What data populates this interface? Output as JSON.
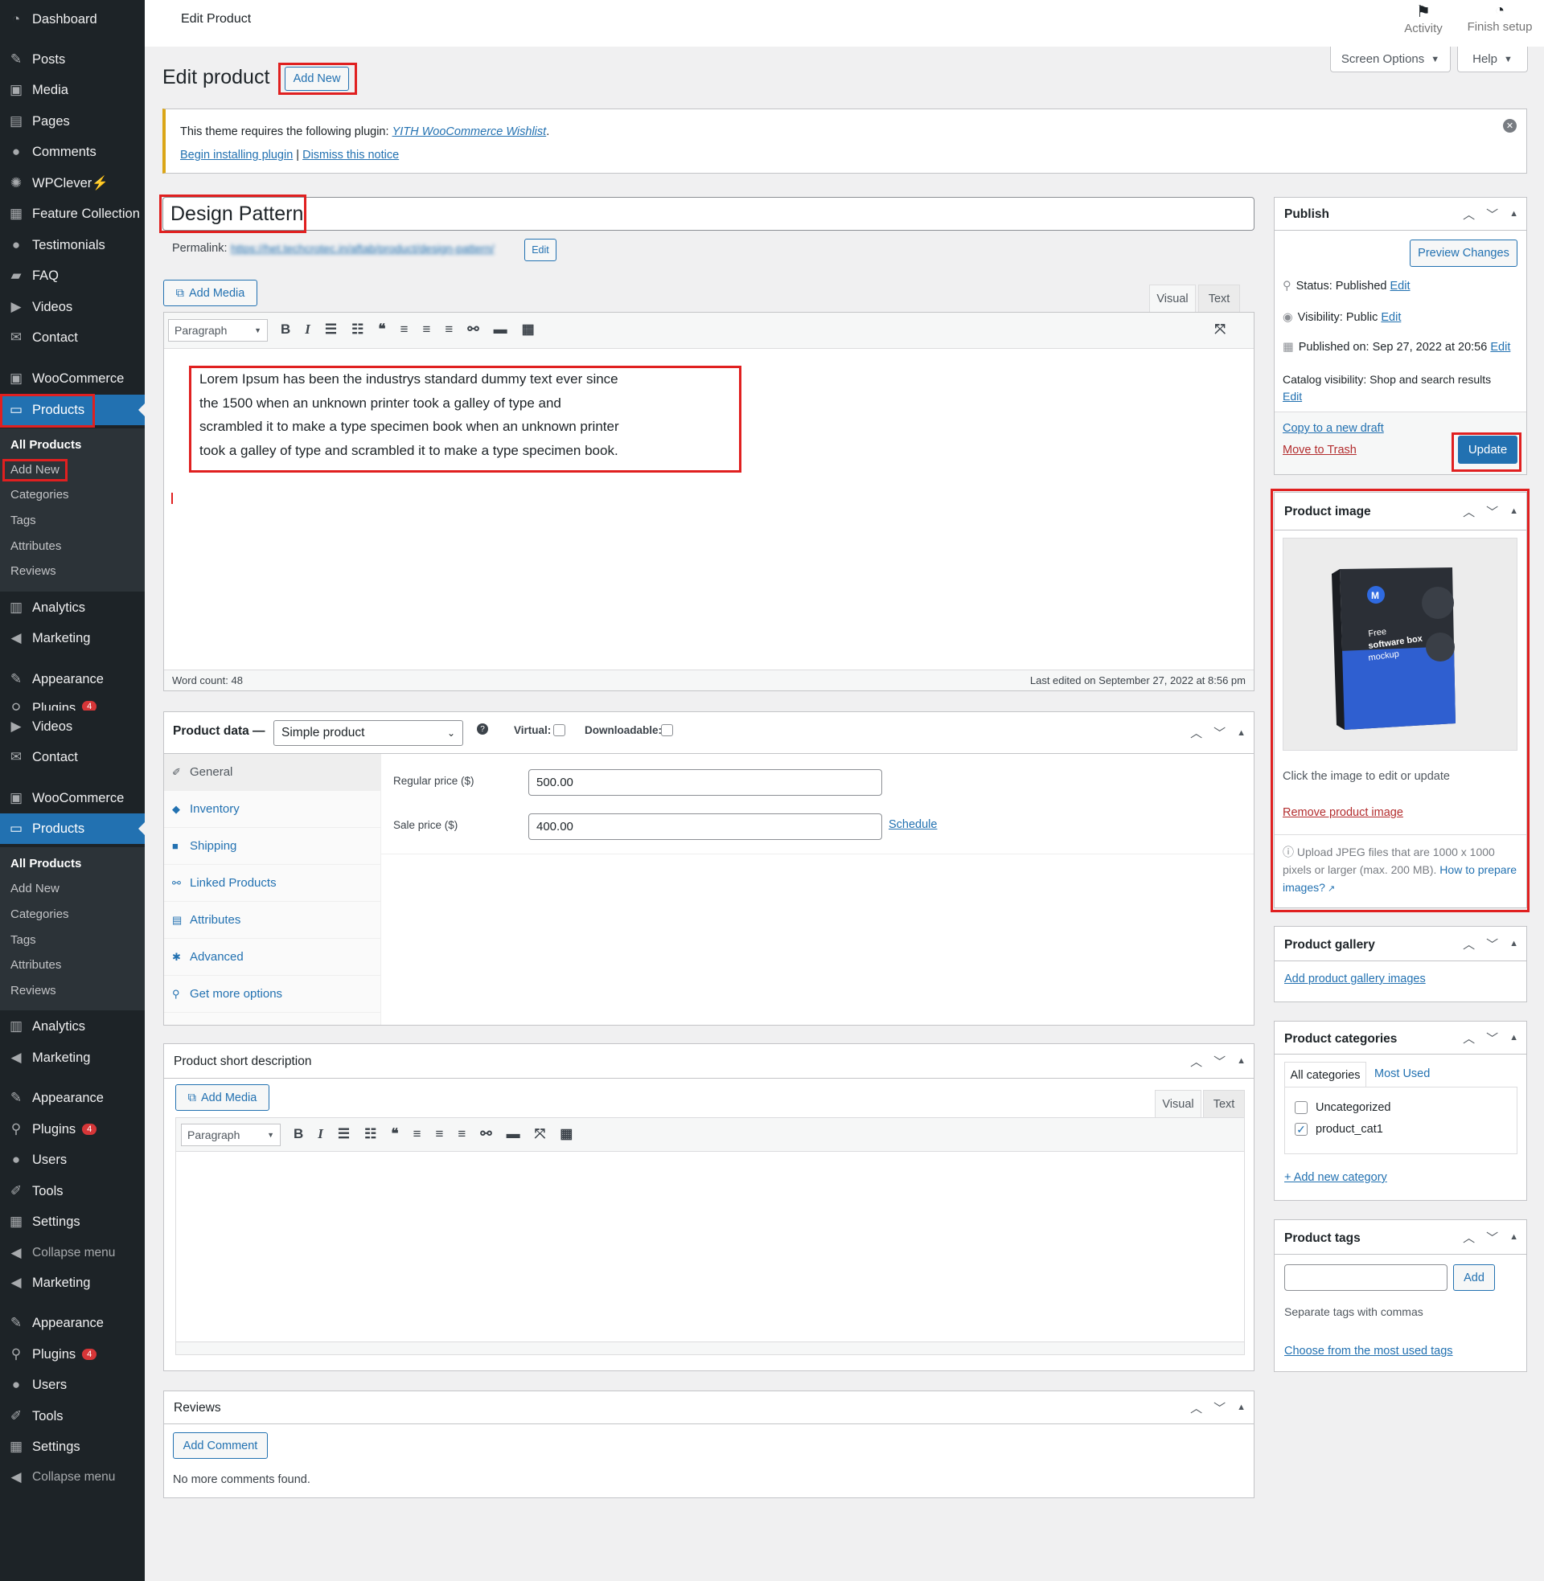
{
  "sidebar": {
    "dashboard": "Dashboard",
    "posts": "Posts",
    "media": "Media",
    "pages": "Pages",
    "comments": "Comments",
    "wpclever": "WPClever⚡",
    "feature_collection": "Feature Collection",
    "testimonials": "Testimonials",
    "faq": "FAQ",
    "videos": "Videos",
    "contact": "Contact",
    "woocommerce": "WooCommerce",
    "products": "Products",
    "analytics": "Analytics",
    "marketing": "Marketing",
    "appearance": "Appearance",
    "plugins": "Plugins",
    "plugins_badge": "4",
    "users": "Users",
    "tools": "Tools",
    "settings": "Settings",
    "collapse": "Collapse menu",
    "products_sub": {
      "all": "All Products",
      "add_new": "Add New",
      "categories": "Categories",
      "tags": "Tags",
      "attributes": "Attributes",
      "reviews": "Reviews"
    }
  },
  "topbar": {
    "title": "Edit Product",
    "activity": "Activity",
    "finish_setup": "Finish setup"
  },
  "header": {
    "heading": "Edit product",
    "add_new": "Add New",
    "screen_options": "Screen Options",
    "help": "Help"
  },
  "notice": {
    "text": "This theme requires the following plugin:",
    "plugin": "YITH WooCommerce Wishlist",
    "period": ".",
    "begin": "Begin installing plugin",
    "sep": "|",
    "dismiss": "Dismiss this notice"
  },
  "post": {
    "title": "Design Pattern",
    "permalink_label": "Permalink:",
    "permalink_url": "https://het.techcrotec.in/aftab/product/design-pattern/",
    "permalink_edit": "Edit",
    "add_media": "Add Media",
    "tab_visual": "Visual",
    "tab_text": "Text",
    "format": "Paragraph",
    "content": "Lorem Ipsum has been the industrys standard dummy text ever since the 1500 when an unknown printer took a galley of type and scrambled it to make a type specimen book when an unknown printer took a galley of type and scrambled it to make a type specimen book.",
    "word_count": "Word count: 48",
    "last_edited": "Last edited on September 27, 2022 at 8:56 pm"
  },
  "product_data": {
    "label": "Product data —",
    "type": "Simple product",
    "virtual": "Virtual:",
    "downloadable": "Downloadable:",
    "tabs": {
      "general": "General",
      "inventory": "Inventory",
      "shipping": "Shipping",
      "linked": "Linked Products",
      "attributes": "Attributes",
      "advanced": "Advanced",
      "more": "Get more options"
    },
    "regular_price_label": "Regular price ($)",
    "regular_price": "500.00",
    "sale_price_label": "Sale price ($)",
    "sale_price": "400.00",
    "schedule": "Schedule"
  },
  "short_desc": {
    "title": "Product short description",
    "add_media": "Add Media",
    "tab_visual": "Visual",
    "tab_text": "Text",
    "format": "Paragraph"
  },
  "reviews": {
    "title": "Reviews",
    "add_comment": "Add Comment",
    "none": "No more comments found."
  },
  "publish": {
    "title": "Publish",
    "preview": "Preview Changes",
    "status_label": "Status:",
    "status": "Published",
    "visibility_label": "Visibility:",
    "visibility": "Public",
    "published_label": "Published on:",
    "published": "Sep 27, 2022 at 20:56",
    "catalog_label": "Catalog visibility:",
    "catalog": "Shop and search results",
    "edit": "Edit",
    "copy": "Copy to a new draft",
    "trash": "Move to Trash",
    "update": "Update"
  },
  "product_image": {
    "title": "Product image",
    "box_free": "Free",
    "box_line2": "software box",
    "box_line3": "mockup",
    "hint": "Click the image to edit or update",
    "remove": "Remove product image",
    "upload_info": "Upload JPEG files that are 1000 x 1000 pixels or larger (max. 200 MB).",
    "how_to": "How to prepare images?"
  },
  "gallery": {
    "title": "Product gallery",
    "add": "Add product gallery images"
  },
  "categories": {
    "title": "Product categories",
    "tab_all": "All categories",
    "tab_used": "Most Used",
    "items": [
      "Uncategorized",
      "product_cat1"
    ],
    "add": "+ Add new category"
  },
  "tags": {
    "title": "Product tags",
    "add": "Add",
    "hint": "Separate tags with commas",
    "choose": "Choose from the most used tags"
  },
  "colors": {
    "accent": "#2271b1",
    "sidebar": "#1d2327",
    "highlight": "#e02020",
    "danger": "#d63638"
  }
}
